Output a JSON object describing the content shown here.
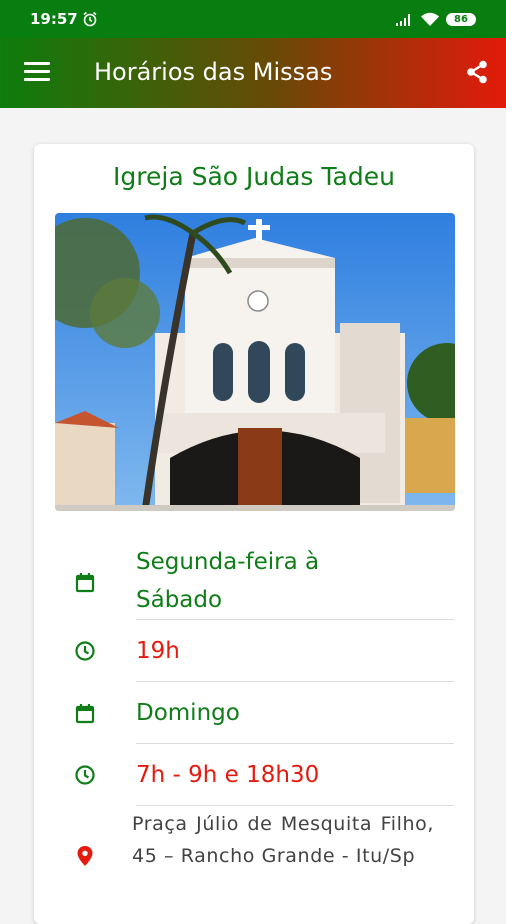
{
  "status_bar": {
    "time": "19:57",
    "battery": "86"
  },
  "app_bar": {
    "title": "Horários das Missas"
  },
  "church": {
    "name": "Igreja São Judas Tadeu",
    "schedule": [
      {
        "days": "Segunda-feira à Sábado",
        "times": "19h"
      },
      {
        "days": "Domingo",
        "times": "7h - 9h e 18h30"
      }
    ],
    "address": "Praça Júlio de Mesquita Filho, 45 – Rancho Grande - Itu/Sp"
  },
  "colors": {
    "green": "#0f7d18",
    "red": "#e41b0e",
    "status_bar": "#087d10"
  }
}
